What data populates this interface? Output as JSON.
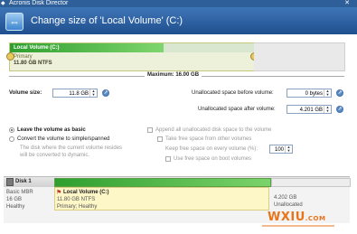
{
  "window": {
    "title": "Acronis Disk Director",
    "close": "✕"
  },
  "header": {
    "title": "Change size of 'Local Volume' (C:)"
  },
  "volume": {
    "name": "Local Volume (C:)",
    "type": "Primary",
    "size_fs": "11.80 GB NTFS",
    "used_fraction": 0.63,
    "size_fraction": 0.73
  },
  "maximum_label": "Maximum: 16.00 GB",
  "fields": {
    "volume_size_label": "Volume size:",
    "volume_size_value": "11.8 GB",
    "before_label": "Unallocated space before volume:",
    "before_value": "0 bytes",
    "after_label": "Unallocated space after volume:",
    "after_value": "4.201 GB"
  },
  "options": {
    "leave_basic": "Leave the volume as basic",
    "convert": "Convert the volume to simple/spanned",
    "convert_note_1": "The disk where the current volume resides",
    "convert_note_2": "will be converted to dynamic.",
    "append": "Append all unallocated disk space to the volume",
    "take_free": "Take free space from other volumes",
    "keep_free": "Keep free space on every volume (%):",
    "keep_free_value": "100",
    "use_boot": "Use free space on boot volumes"
  },
  "disk": {
    "name": "Disk 1",
    "type": "Basic MBR",
    "size": "16 GB",
    "status": "Healthy",
    "partition_name": "Local Volume (C:)",
    "partition_size": "11.80 GB NTFS",
    "partition_status": "Primary; Healthy",
    "unalloc_size": "4.202 GB",
    "unalloc_label": "Unallocated"
  },
  "watermark": {
    "text": "WXIU",
    "suffix": ".COM"
  },
  "colors": {
    "accent": "#2f5f98",
    "volume_fill": "#2f9e2f",
    "watermark": "#e8741b"
  }
}
